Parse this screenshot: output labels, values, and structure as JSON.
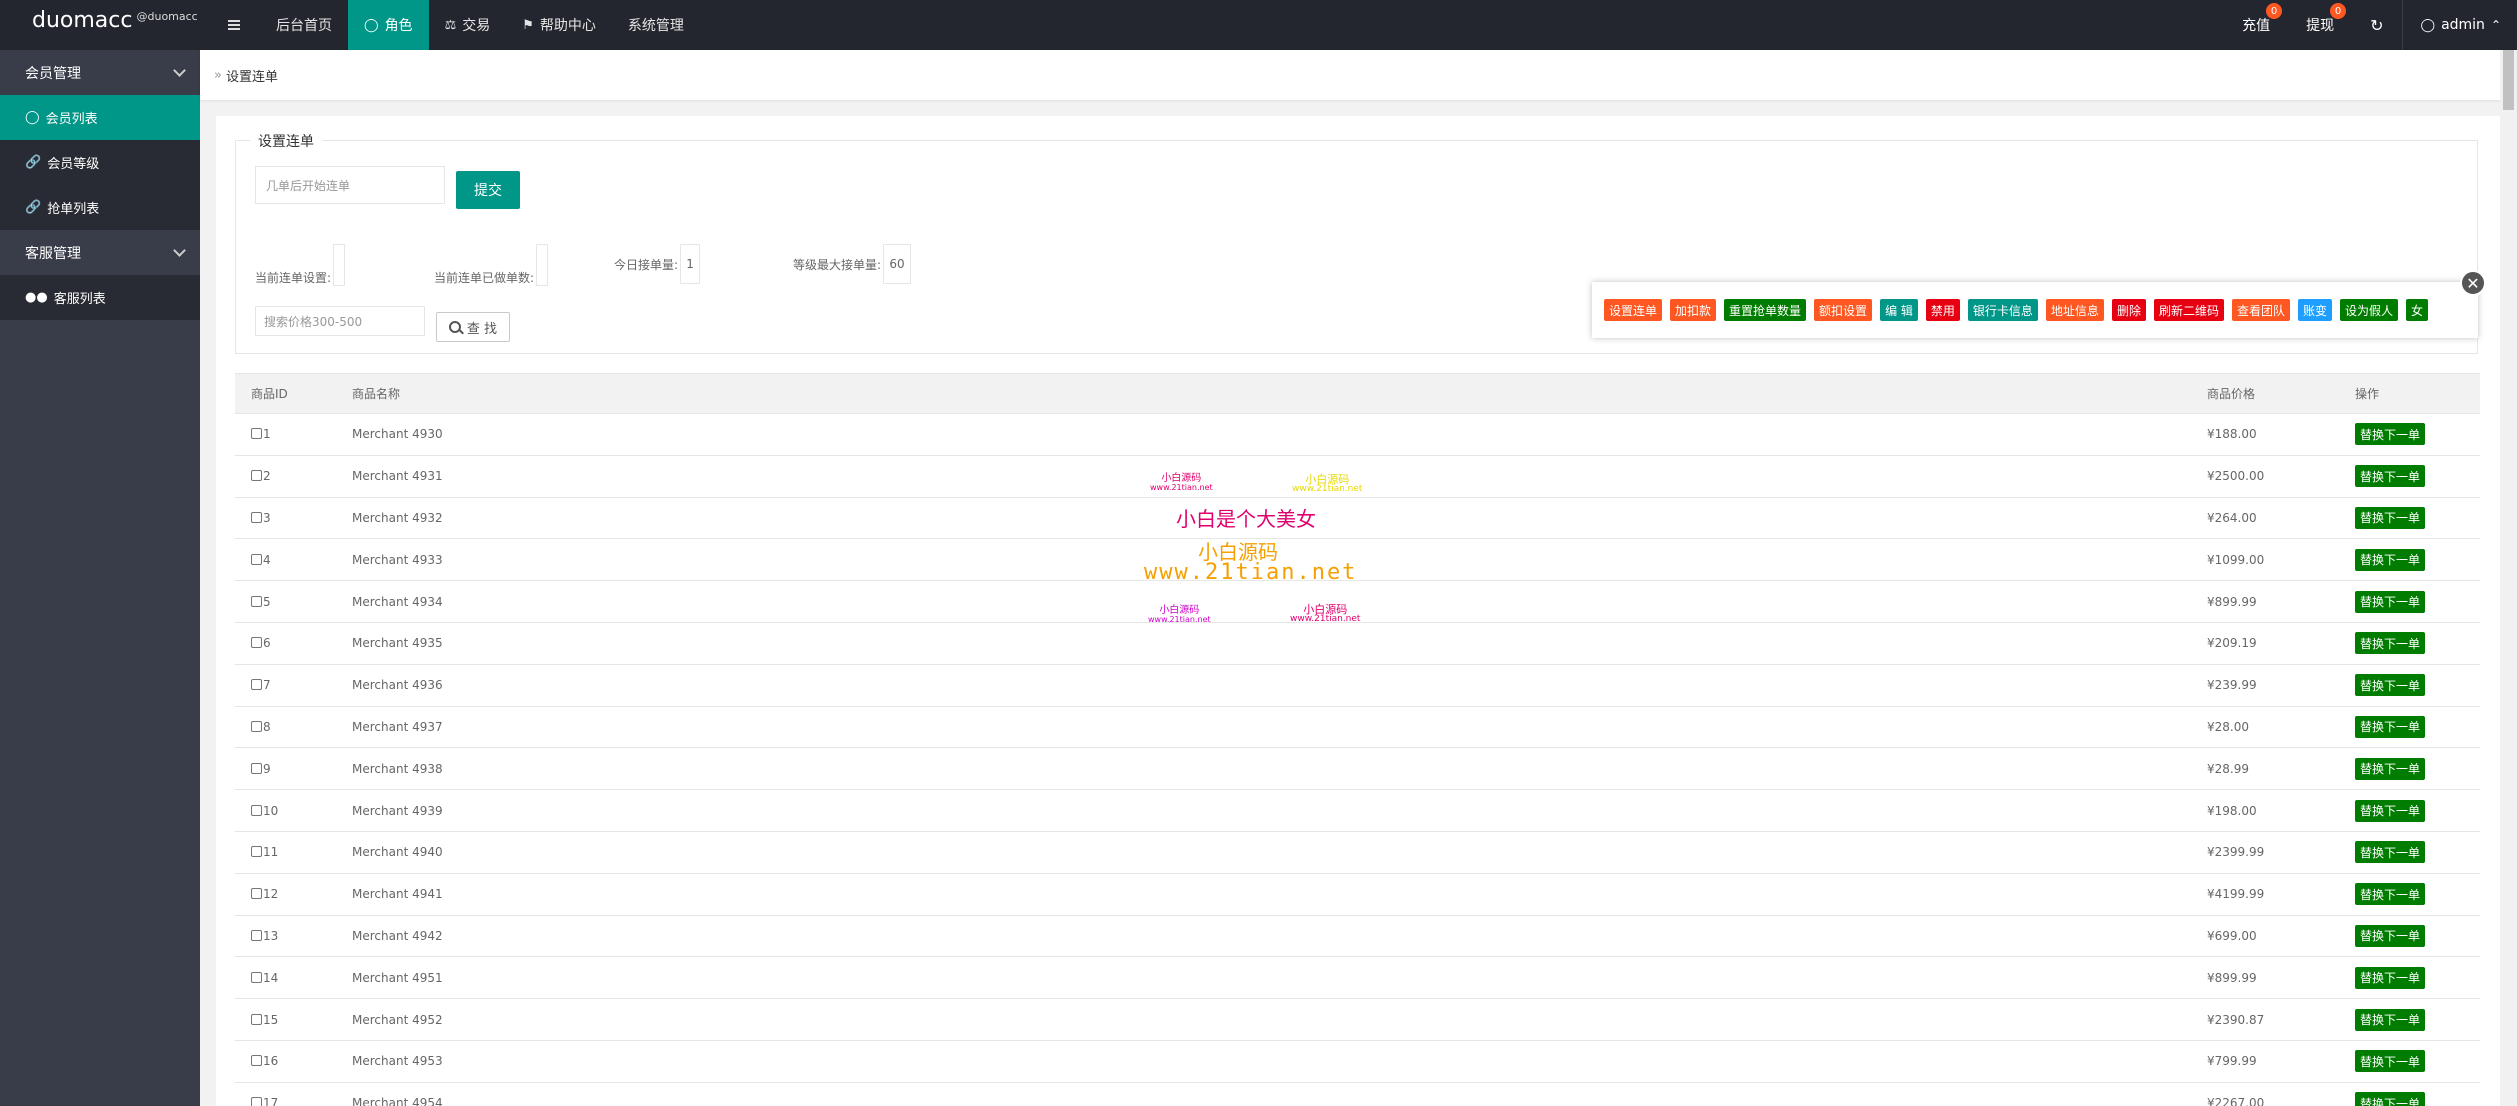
{
  "header": {
    "brand": "duomacc",
    "brand_sub": "@duomacc",
    "nav": [
      {
        "label": "后台首页",
        "icon": ""
      },
      {
        "label": "角色",
        "icon": "user-icon"
      },
      {
        "label": "交易",
        "icon": "scale-icon"
      },
      {
        "label": "帮助中心",
        "icon": "flag-icon"
      },
      {
        "label": "系统管理",
        "icon": ""
      }
    ],
    "recharge": "充值",
    "recharge_badge": "0",
    "withdraw": "提现",
    "withdraw_badge": "0",
    "admin": "admin"
  },
  "sidebar": {
    "groups": [
      {
        "label": "会员管理",
        "items": [
          "会员列表",
          "会员等级",
          "抢单列表"
        ]
      },
      {
        "label": "客服管理",
        "items": [
          "客服列表"
        ]
      }
    ]
  },
  "breadcrumb": "设置连单",
  "form": {
    "legend": "设置连单",
    "count_placeholder": "几单后开始连单",
    "submit": "提交",
    "current_setting_label": "当前连单设置:",
    "current_setting_value": "",
    "done_count_label": "当前连单已做单数:",
    "done_count_value": "",
    "today_label": "今日接单量:",
    "today_value": "1",
    "max_label": "等级最大接单量:",
    "max_value": "60",
    "price_placeholder": "搜索价格300-500",
    "search": "查 找"
  },
  "actions": [
    {
      "label": "设置连单",
      "color": "#ff5722"
    },
    {
      "label": "加扣款",
      "color": "#ff5722"
    },
    {
      "label": "重置抢单数量",
      "color": "#007d00"
    },
    {
      "label": "额扣设置",
      "color": "#ff5722"
    },
    {
      "label": "编 辑",
      "color": "#009688"
    },
    {
      "label": "禁用",
      "color": "#e60012"
    },
    {
      "label": "银行卡信息",
      "color": "#009688"
    },
    {
      "label": "地址信息",
      "color": "#ff5722"
    },
    {
      "label": "删除",
      "color": "#e60012"
    },
    {
      "label": "刷新二维码",
      "color": "#e60012"
    },
    {
      "label": "查看团队",
      "color": "#ff5722"
    },
    {
      "label": "账变",
      "color": "#1e9fff"
    },
    {
      "label": "设为假人",
      "color": "#007d00"
    },
    {
      "label": "女",
      "color": "#007d00"
    }
  ],
  "table": {
    "headers": [
      "商品ID",
      "商品名称",
      "商品价格",
      "操作"
    ],
    "button_label": "替换下一单",
    "rows": [
      {
        "id": "1",
        "name": "Merchant 4930",
        "price": "¥188.00"
      },
      {
        "id": "2",
        "name": "Merchant 4931",
        "price": "¥2500.00"
      },
      {
        "id": "3",
        "name": "Merchant 4932",
        "price": "¥264.00"
      },
      {
        "id": "4",
        "name": "Merchant 4933",
        "price": "¥1099.00"
      },
      {
        "id": "5",
        "name": "Merchant 4934",
        "price": "¥899.99"
      },
      {
        "id": "6",
        "name": "Merchant 4935",
        "price": "¥209.19"
      },
      {
        "id": "7",
        "name": "Merchant 4936",
        "price": "¥239.99"
      },
      {
        "id": "8",
        "name": "Merchant 4937",
        "price": "¥28.00"
      },
      {
        "id": "9",
        "name": "Merchant 4938",
        "price": "¥28.99"
      },
      {
        "id": "10",
        "name": "Merchant 4939",
        "price": "¥198.00"
      },
      {
        "id": "11",
        "name": "Merchant 4940",
        "price": "¥2399.99"
      },
      {
        "id": "12",
        "name": "Merchant 4941",
        "price": "¥4199.99"
      },
      {
        "id": "13",
        "name": "Merchant 4942",
        "price": "¥699.00"
      },
      {
        "id": "14",
        "name": "Merchant 4951",
        "price": "¥899.99"
      },
      {
        "id": "15",
        "name": "Merchant 4952",
        "price": "¥2390.87"
      },
      {
        "id": "16",
        "name": "Merchant 4953",
        "price": "¥799.99"
      },
      {
        "id": "17",
        "name": "Merchant 4954",
        "price": "¥2267.00"
      }
    ]
  },
  "watermark": {
    "small_a": "小白源码",
    "small_a_url": "www.21tian.net",
    "small_b": "小白源码",
    "small_b_url": "www.21tian.net",
    "line1": "小白是个大美女",
    "line2": "小白源码",
    "line3": "www.21tian.net",
    "small_c": "小白源码",
    "small_c_url": "www.21tian.net",
    "small_d": "小白源码",
    "small_d_url": "www.21tian.net"
  }
}
